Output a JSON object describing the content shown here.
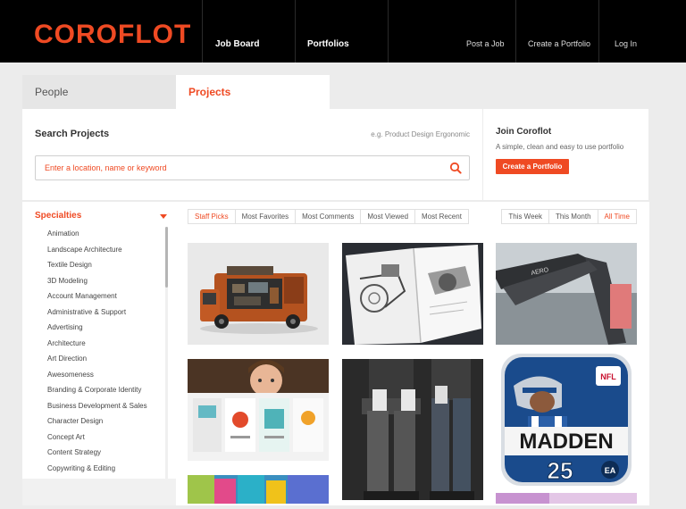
{
  "header": {
    "logo": "COROFLOT",
    "nav_left": [
      "Job Board",
      "Portfolios"
    ],
    "nav_right": [
      "Post a Job",
      "Create a Portfolio",
      "Log In"
    ]
  },
  "tabs": [
    {
      "label": "People",
      "active": false
    },
    {
      "label": "Projects",
      "active": true
    }
  ],
  "search": {
    "title": "Search Projects",
    "hint": "e.g. Product Design Ergonomic",
    "placeholder": "Enter a location, name or keyword"
  },
  "join": {
    "title": "Join Coroflot",
    "subtitle": "A simple, clean and easy to use portfolio",
    "button": "Create a Portfolio"
  },
  "sidebar": {
    "heading": "Specialties",
    "items": [
      "Animation",
      "Landscape Architecture",
      "Textile Design",
      "3D Modeling",
      "Account Management",
      "Administrative & Support",
      "Advertising",
      "Architecture",
      "Art Direction",
      "Awesomeness",
      "Branding & Corporate Identity",
      "Business Development & Sales",
      "Character Design",
      "Concept Art",
      "Content Strategy",
      "Copywriting & Editing"
    ]
  },
  "filters": {
    "sort": [
      {
        "label": "Staff Picks",
        "active": true
      },
      {
        "label": "Most Favorites",
        "active": false
      },
      {
        "label": "Most Comments",
        "active": false
      },
      {
        "label": "Most Viewed",
        "active": false
      },
      {
        "label": "Most Recent",
        "active": false
      }
    ],
    "time": [
      {
        "label": "This Week",
        "active": false
      },
      {
        "label": "This Month",
        "active": false
      },
      {
        "label": "All Time",
        "active": true
      }
    ]
  },
  "projects": {
    "madden_title": "MADDEN",
    "madden_badge": "NFL",
    "madden_number": "25",
    "madden_brand": "EA"
  },
  "colors": {
    "accent": "#ef4a23",
    "header_bg": "#000000",
    "page_bg": "#ececec"
  }
}
